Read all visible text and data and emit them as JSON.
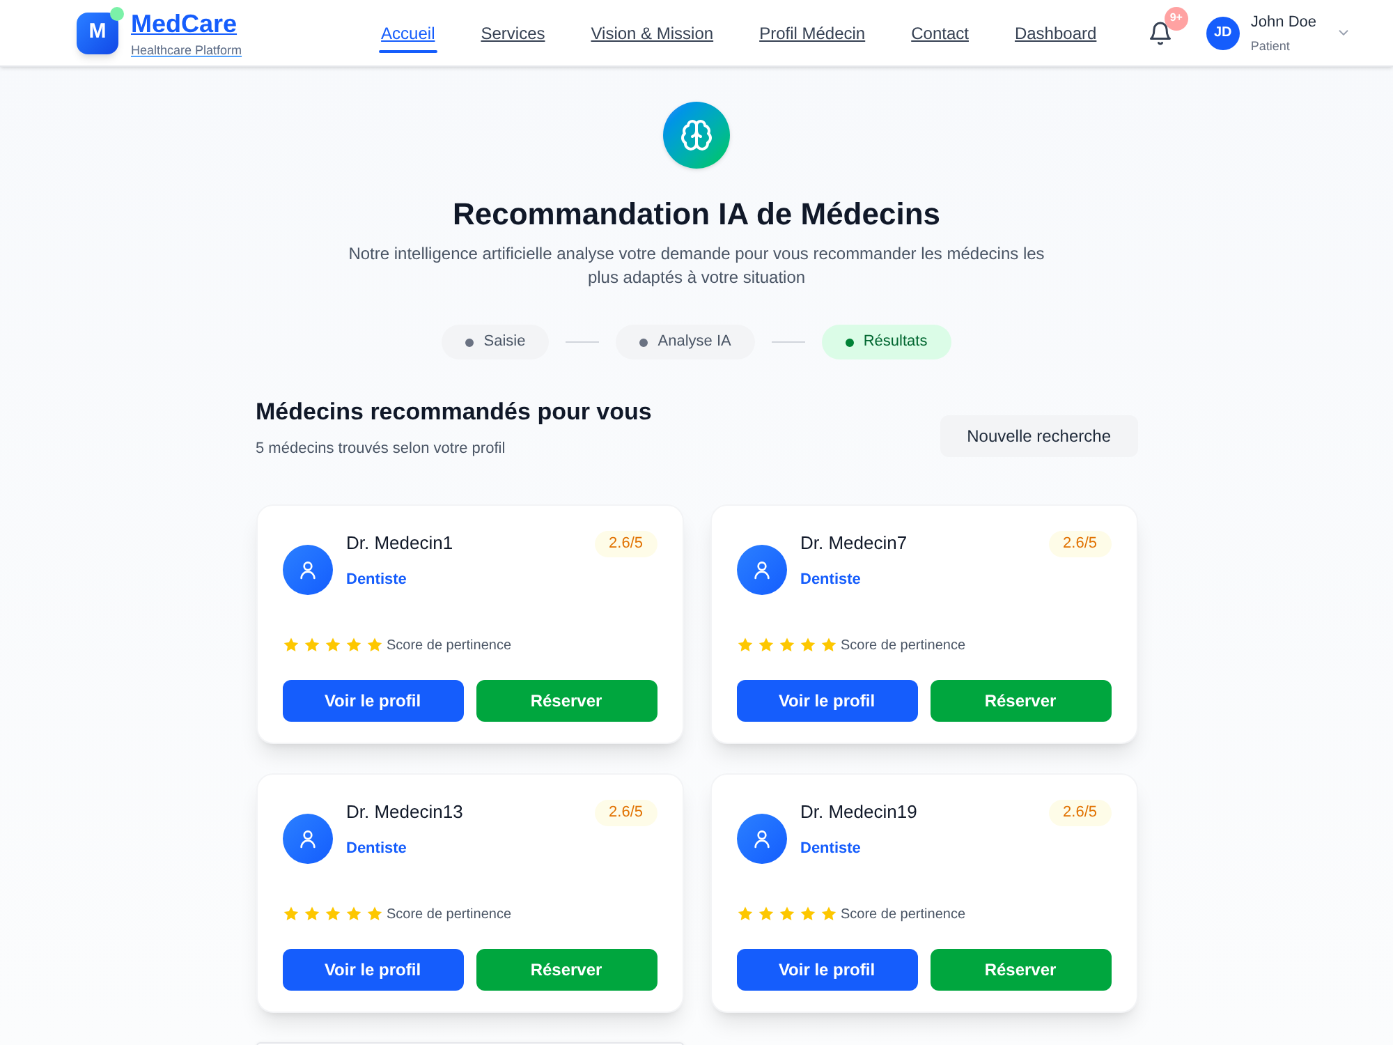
{
  "header": {
    "logo": {
      "letter": "M",
      "name": "MedCare",
      "tagline": "Healthcare Platform"
    },
    "nav": [
      {
        "label": "Accueil",
        "selected": true
      },
      {
        "label": "Services",
        "selected": false
      },
      {
        "label": "Vision & Mission",
        "selected": false
      },
      {
        "label": "Profil Médecin",
        "selected": false
      },
      {
        "label": "Contact",
        "selected": false
      },
      {
        "label": "Dashboard",
        "selected": false
      }
    ],
    "notifications": {
      "badge": "9+"
    },
    "user": {
      "initials": "JD",
      "name": "John Doe",
      "role": "Patient"
    }
  },
  "hero": {
    "title": "Recommandation IA de Médecins",
    "subtitle": "Notre intelligence artificielle analyse votre demande pour vous recommander les médecins les plus adaptés à votre situation"
  },
  "steps": [
    {
      "label": "Saisie",
      "active": false
    },
    {
      "label": "Analyse IA",
      "active": false
    },
    {
      "label": "Résultats",
      "active": true
    }
  ],
  "results": {
    "title": "Médecins recommandés pour vous",
    "count": "5 médecins trouvés selon votre profil",
    "new_search_button": "Nouvelle recherche"
  },
  "doctors": [
    {
      "name": "Dr. Medecin1",
      "specialty": "Dentiste",
      "rating": "2.6/5",
      "stars": 5,
      "score_label": "Score de pertinence",
      "profile_button": "Voir le profil",
      "book_button": "Réserver"
    },
    {
      "name": "Dr. Medecin7",
      "specialty": "Dentiste",
      "rating": "2.6/5",
      "stars": 5,
      "score_label": "Score de pertinence",
      "profile_button": "Voir le profil",
      "book_button": "Réserver"
    },
    {
      "name": "Dr. Medecin13",
      "specialty": "Dentiste",
      "rating": "2.6/5",
      "stars": 5,
      "score_label": "Score de pertinence",
      "profile_button": "Voir le profil",
      "book_button": "Réserver"
    },
    {
      "name": "Dr. Medecin19",
      "specialty": "Dentiste",
      "rating": "2.6/5",
      "stars": 5,
      "score_label": "Score de pertinence",
      "profile_button": "Voir le profil",
      "book_button": "Réserver"
    }
  ]
}
